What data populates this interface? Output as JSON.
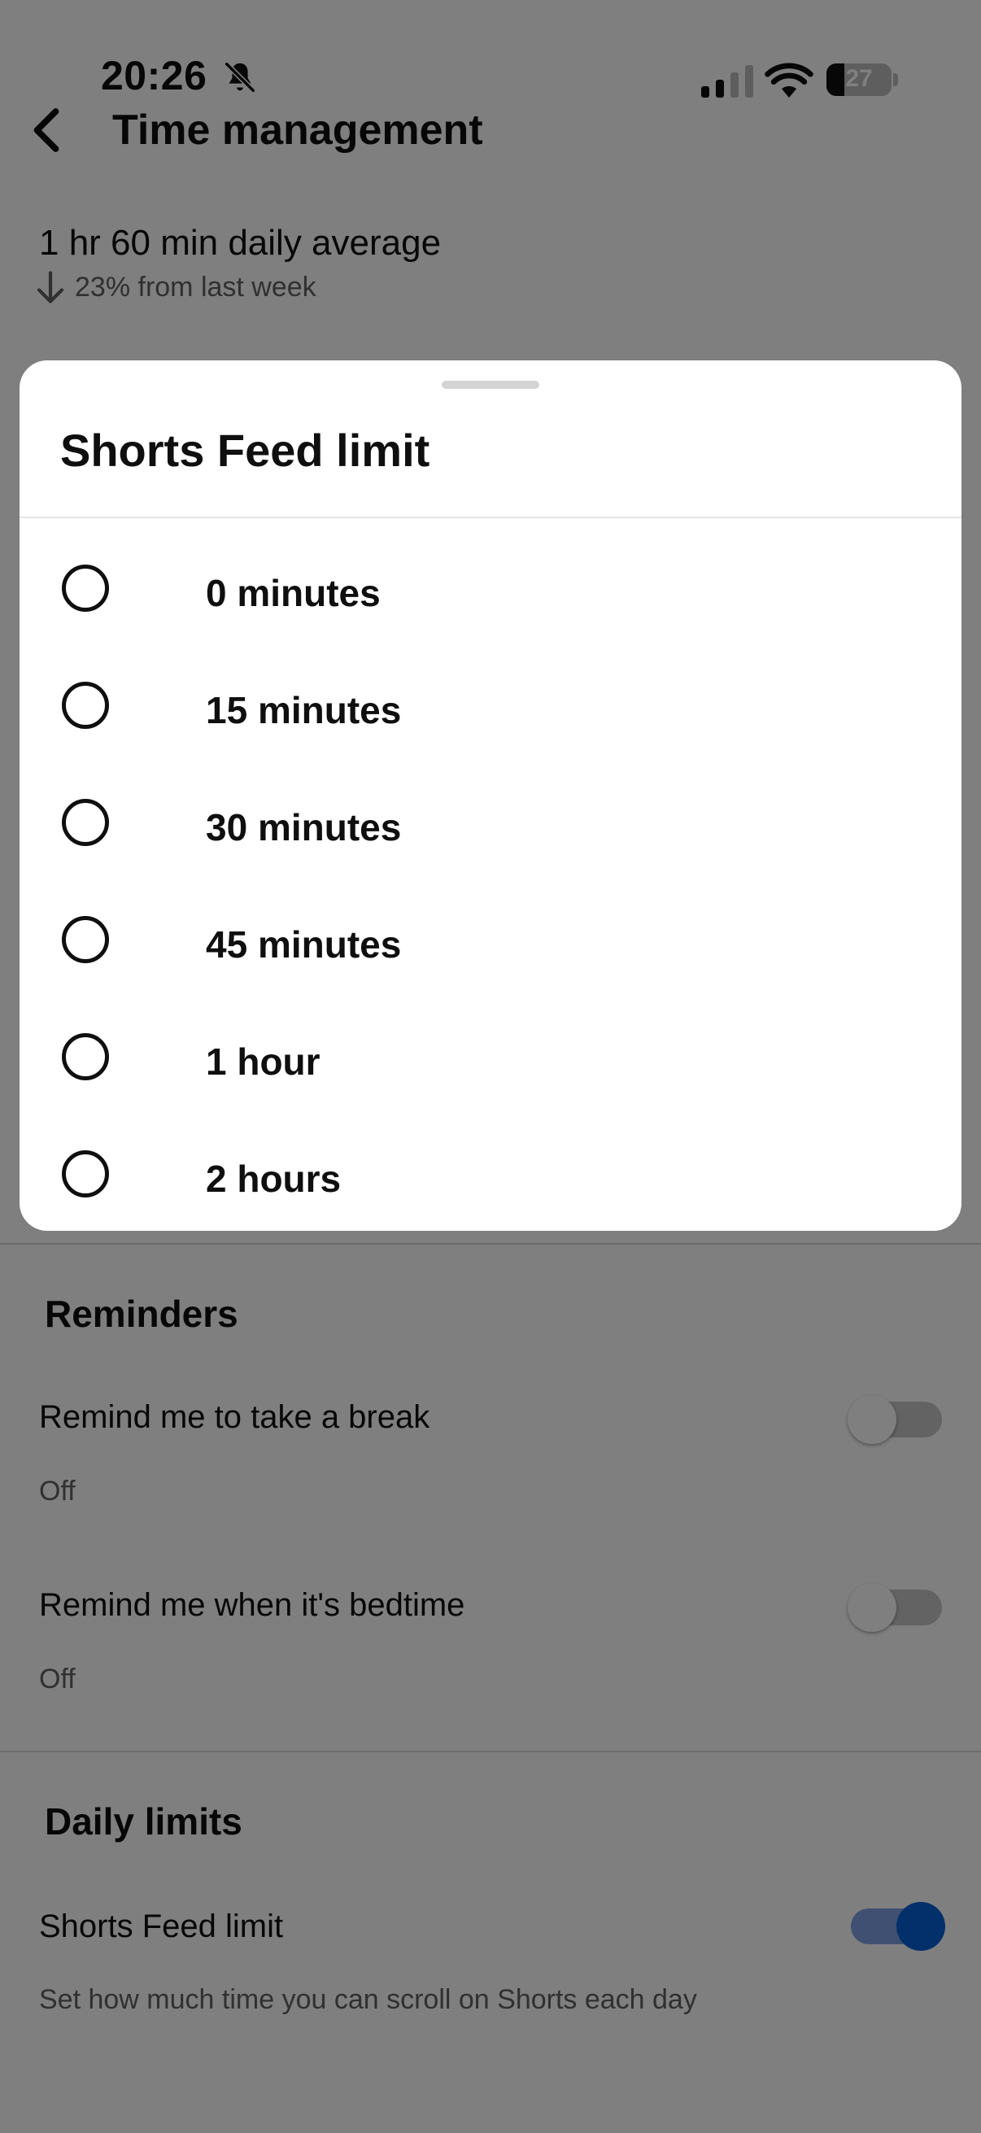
{
  "status_bar": {
    "time": "20:26",
    "battery": "27",
    "battery_level_percent": 27,
    "icons": [
      "bell-muted-icon",
      "cellular-signal-icon",
      "wifi-icon",
      "battery-icon"
    ]
  },
  "header": {
    "title": "Time management",
    "back_icon": "chevron-left-icon"
  },
  "summary": {
    "average": "1 hr 60 min daily average",
    "trend": "23% from last week",
    "trend_icon": "arrow-down-icon"
  },
  "reminders": {
    "heading": "Reminders",
    "items": [
      {
        "label": "Remind me to take a break",
        "status": "Off",
        "enabled": false
      },
      {
        "label": "Remind me when it's bedtime",
        "status": "Off",
        "enabled": false
      }
    ]
  },
  "daily_limits": {
    "heading": "Daily limits",
    "items": [
      {
        "label": "Shorts Feed limit",
        "description": "Set how much time you can scroll on Shorts each day",
        "enabled": true
      }
    ]
  },
  "sheet": {
    "title": "Shorts Feed limit",
    "options": [
      {
        "label": "0 minutes",
        "selected": false
      },
      {
        "label": "15 minutes",
        "selected": false
      },
      {
        "label": "30 minutes",
        "selected": false
      },
      {
        "label": "45 minutes",
        "selected": false
      },
      {
        "label": "1 hour",
        "selected": false
      },
      {
        "label": "2 hours",
        "selected": false
      }
    ]
  },
  "colors": {
    "scrim": "#000000",
    "accent": "#065fd4",
    "toggle_on_track": "#7ea0e6",
    "toggle_off_track": "#c6c6c6",
    "text_primary": "#0f0f0f",
    "text_secondary": "#606060"
  }
}
